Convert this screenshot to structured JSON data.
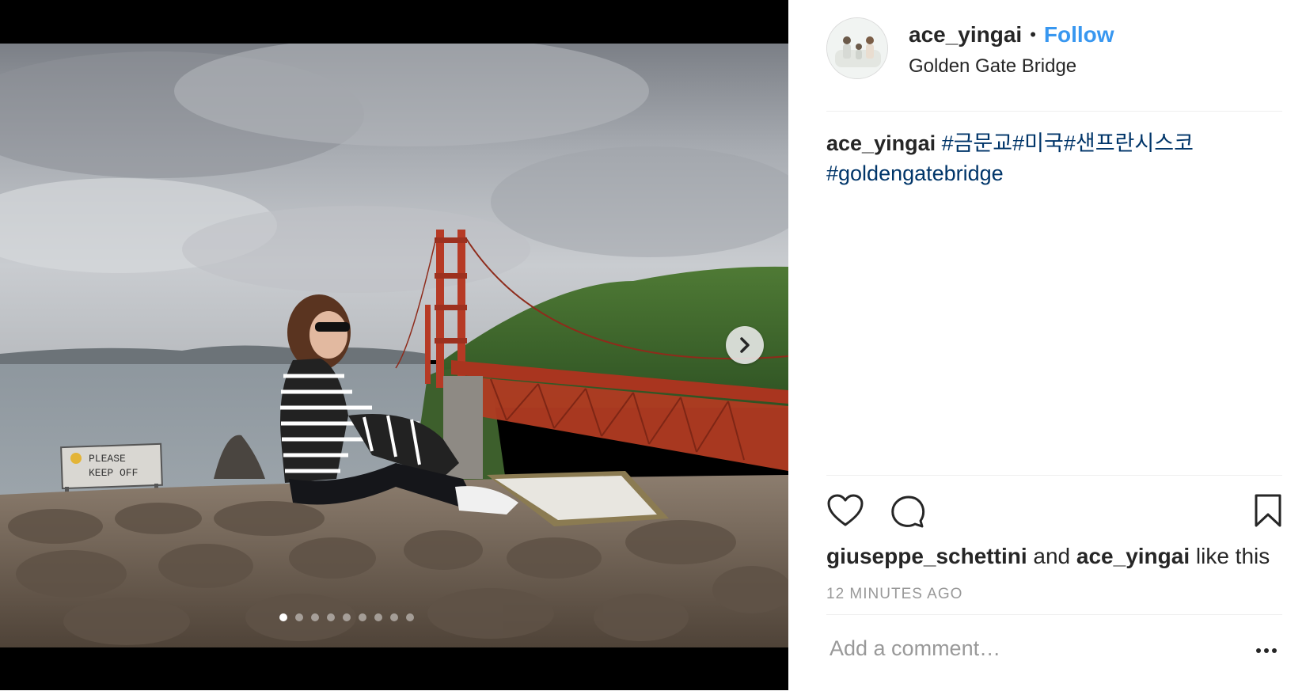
{
  "post": {
    "user": "ace_yingai",
    "separator": "•",
    "follow_label": "Follow",
    "location": "Golden Gate Bridge"
  },
  "caption": {
    "username": "ace_yingai",
    "hashtags": [
      "#금문교",
      "#미국",
      "#샌프란시스코",
      "#goldengatebridge"
    ]
  },
  "likes": {
    "user1": "giuseppe_schettini",
    "joiner": "and",
    "user2": "ace_yingai",
    "suffix": "like this"
  },
  "timestamp": "12 MINUTES AGO",
  "comment": {
    "placeholder": "Add a comment…"
  },
  "carousel": {
    "total_slides": 9,
    "active_index": 0
  },
  "photo_sign": [
    "PLEASE",
    "KEEP OFF"
  ],
  "colors": {
    "accent": "#3897f0",
    "hashtag": "#003569",
    "muted": "#999999",
    "bridge": "#b63a25"
  }
}
